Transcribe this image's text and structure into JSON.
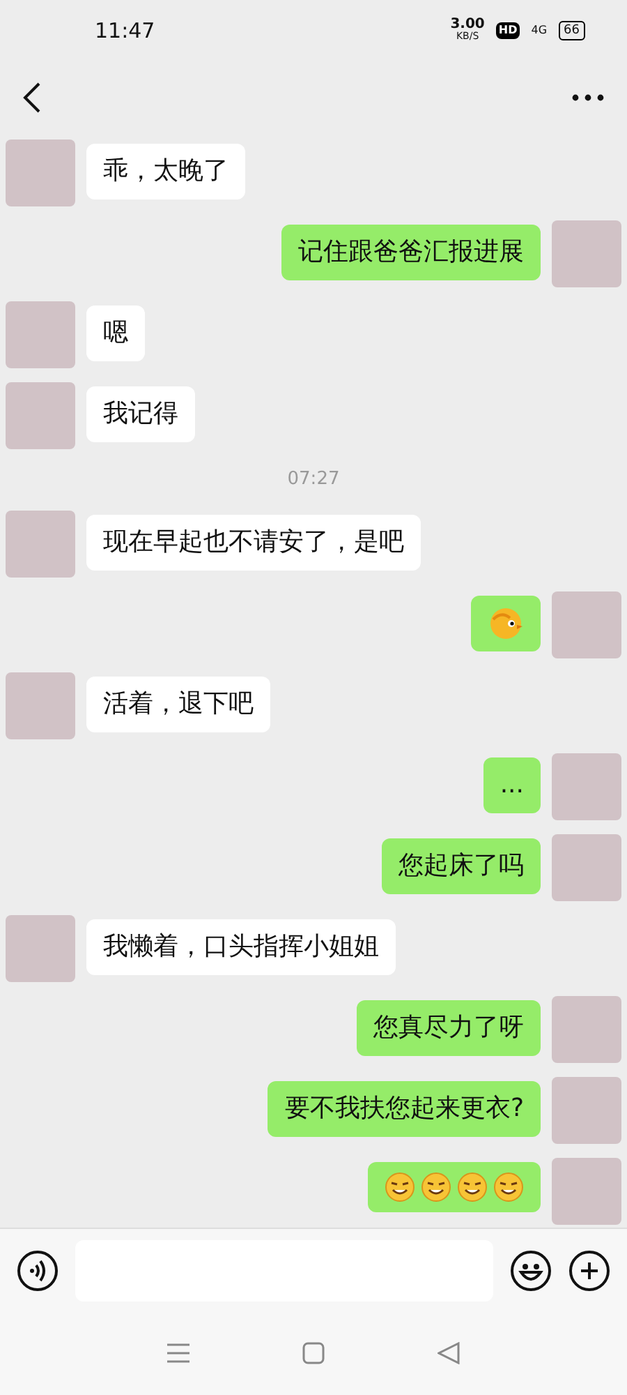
{
  "status_bar": {
    "time": "11:47",
    "speed": "3.00",
    "speed_unit": "KB/S",
    "hd": "HD",
    "network": "4G",
    "battery": "66"
  },
  "messages": [
    {
      "kind": "text",
      "outgoing": false,
      "text": "乖，太晚了"
    },
    {
      "kind": "text",
      "outgoing": true,
      "text": "记住跟爸爸汇报进展"
    },
    {
      "kind": "text",
      "outgoing": false,
      "text": "嗯"
    },
    {
      "kind": "text",
      "outgoing": false,
      "text": "我记得"
    },
    {
      "kind": "time",
      "text": "07:27"
    },
    {
      "kind": "text",
      "outgoing": false,
      "text": "现在早起也不请安了，是吧"
    },
    {
      "kind": "sticker",
      "outgoing": true
    },
    {
      "kind": "text",
      "outgoing": false,
      "text": "活着，退下吧"
    },
    {
      "kind": "text",
      "outgoing": true,
      "text": "..."
    },
    {
      "kind": "text",
      "outgoing": true,
      "text": "您起床了吗"
    },
    {
      "kind": "text",
      "outgoing": false,
      "text": "我懒着，口头指挥小姐姐"
    },
    {
      "kind": "text",
      "outgoing": true,
      "text": "您真尽力了呀"
    },
    {
      "kind": "text",
      "outgoing": true,
      "text": "要不我扶您起来更衣?"
    },
    {
      "kind": "emoji_row",
      "outgoing": true
    }
  ]
}
